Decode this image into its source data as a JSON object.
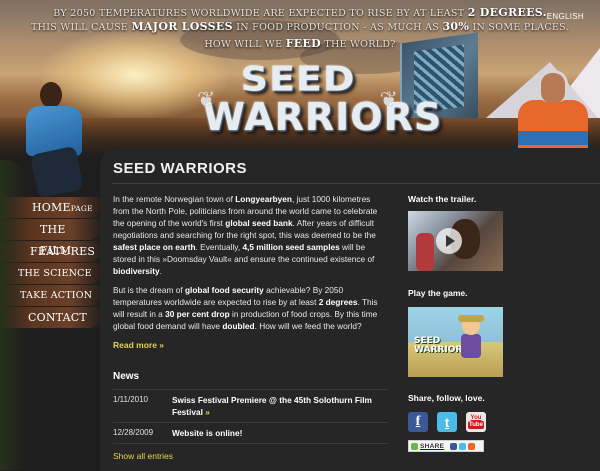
{
  "header": {
    "tagline_line1_pre": "By 2050 temperatures worldwide are expected to rise by at least",
    "tagline_line1_bold": "2 degrees.",
    "tagline_line2_pre": "This will cause",
    "tagline_line2_bold1": "major losses",
    "tagline_line2_mid": "in food production - as much as",
    "tagline_line2_bold2": "30%",
    "tagline_line2_post": "in some places.",
    "tagline_line3_pre": "How will we",
    "tagline_line3_bold": "feed",
    "tagline_line3_post": "the world?",
    "language": "ENGLISH",
    "logo_line1": "SEED",
    "logo_line2": "WARRIORS"
  },
  "nav": {
    "items": [
      {
        "label_a": "HOME",
        "label_b": "page"
      },
      {
        "label_a": "The FILM",
        "label_b": ""
      },
      {
        "label_a": "FEATURES",
        "label_b": ""
      },
      {
        "label_a": "The SCIENCE",
        "label_b": ""
      },
      {
        "label_a": "TAKE ACTION",
        "label_b": ""
      },
      {
        "label_a": "CONTACT",
        "label_b": ""
      }
    ]
  },
  "main": {
    "title": "SEED WARRIORS",
    "p1": {
      "t1": "In the remote Norwegian town of ",
      "b1": "Longyearbyen",
      "t2": ", just 1000 kilometres from the North Pole, politicians from around the world came to celebrate the opening of the world's first ",
      "b2": "global seed bank",
      "t3": ". After years of difficult negotiations and searching for the right spot, this was deemed to be the ",
      "b3": "safest place on earth",
      "t4": ". Eventually, ",
      "b4": "4,5 million seed samples",
      "t5": " will be stored in this »Doomsday Vault« and ensure the continued existence of ",
      "b5": "biodiversity",
      "t6": "."
    },
    "p2": {
      "t1": "But is the dream of ",
      "b1": "global food security",
      "t2": " achievable? By 2050 temperatures worldwide are expected to rise by at least ",
      "b2": "2 degrees",
      "t3": ". This will result in a ",
      "b3": "30 per cent drop",
      "t4": " in production of food crops. By this time global food demand will have ",
      "b4": "doubled",
      "t5": ". How will we feed the world?"
    },
    "read_more": "Read more »"
  },
  "news": {
    "title": "News",
    "items": [
      {
        "date": "1/11/2010",
        "text": "Swiss Festival Premiere @ the 45th Solothurn Film Festival",
        "more": "»"
      },
      {
        "date": "12/28/2009",
        "text": "Website is online!",
        "more": ""
      }
    ],
    "show_all": "Show all entries"
  },
  "sidebar": {
    "trailer_heading": "Watch the trailer.",
    "game_heading": "Play the game.",
    "game_title_1": "SEED",
    "game_title_2": "WARRIORS",
    "social_heading": "Share, follow, love.",
    "facebook": "f",
    "twitter": "t",
    "youtube_a": "You",
    "youtube_b": "Tube",
    "share_label": "SHARE"
  }
}
